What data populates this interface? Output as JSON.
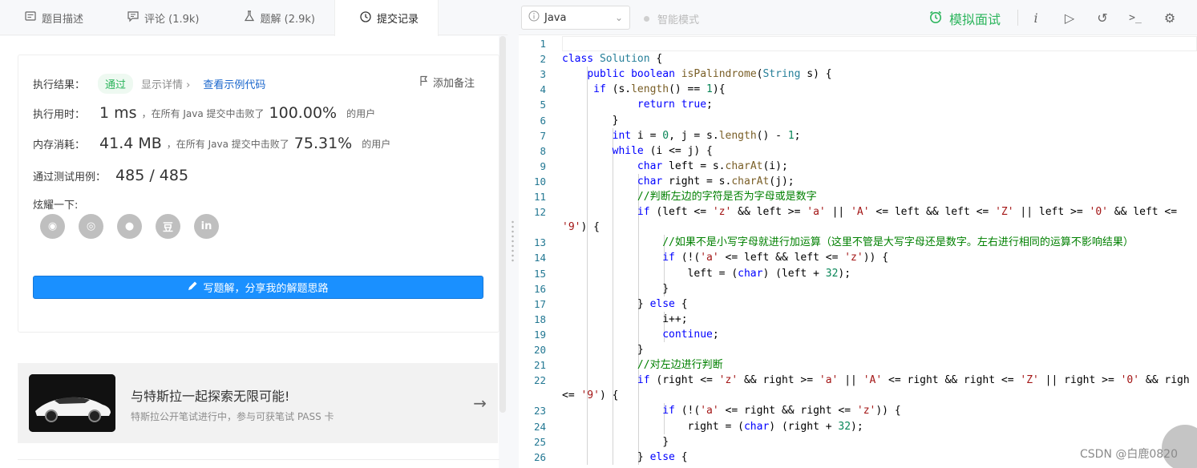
{
  "tabs": [
    {
      "label": "题目描述",
      "icon": "document-icon"
    },
    {
      "label": "评论 (1.9k)",
      "icon": "comment-icon"
    },
    {
      "label": "题解 (2.9k)",
      "icon": "flask-icon"
    },
    {
      "label": "提交记录",
      "icon": "clock-icon"
    }
  ],
  "result": {
    "exec_label": "执行结果：",
    "status": "通过",
    "detail_link": "显示详情 ›",
    "sample_link": "查看示例代码",
    "add_note": "添加备注",
    "time_label": "执行用时：",
    "time_value": "1 ms",
    "time_mid": "，在所有 Java 提交中击败了",
    "time_pct": "100.00%",
    "time_suffix": "的用户",
    "mem_label": "内存消耗：",
    "mem_value": "41.4 MB",
    "mem_mid": "，在所有 Java 提交中击败了",
    "mem_pct": "75.31%",
    "mem_suffix": "的用户",
    "cases_label": "通过测试用例：",
    "cases_value": "485 / 485",
    "share_label": "炫耀一下:",
    "share_icons": [
      "wechat-icon",
      "weibo-icon",
      "qq-icon",
      "douban-icon",
      "linkedin-icon"
    ],
    "share_glyphs": [
      "◉",
      "◎",
      "●",
      "豆",
      "in"
    ],
    "write_button": "写题解，分享我的解题思路"
  },
  "ad": {
    "title": "与特斯拉一起探索无限可能!",
    "subtitle": "特斯拉公开笔试进行中，参与可获笔试 PASS 卡",
    "arrow": "→"
  },
  "toolbar": {
    "language": "Java",
    "smart_mode": "智能模式",
    "mock_interview": "模拟面试",
    "info_glyph": "i",
    "run_glyph": "▷",
    "reset_glyph": "↺",
    "console_glyph": ">_",
    "settings_glyph": "⚙"
  },
  "code_lines": [
    {
      "n": "1",
      "html": ""
    },
    {
      "n": "2",
      "html": "<span class='kw'>class</span> <span class='ty'>Solution</span> {"
    },
    {
      "n": "3",
      "html": "    <span class='kw'>public</span> <span class='kw'>boolean</span> <span class='fn'>isPalindrome</span>(<span class='ty'>String</span> s) {"
    },
    {
      "n": "4",
      "html": "     <span class='kw'>if</span> (s.<span class='fn'>length</span>() == <span class='nm'>1</span>){"
    },
    {
      "n": "5",
      "html": "            <span class='kw'>return</span> <span class='kw'>true</span>;"
    },
    {
      "n": "6",
      "html": "        }"
    },
    {
      "n": "7",
      "html": "        <span class='kw'>int</span> i = <span class='nm'>0</span>, j = s.<span class='fn'>length</span>() - <span class='nm'>1</span>;"
    },
    {
      "n": "8",
      "html": "        <span class='kw'>while</span> (i &lt;= j) {"
    },
    {
      "n": "9",
      "html": "            <span class='kw'>char</span> left = s.<span class='fn'>charAt</span>(i);"
    },
    {
      "n": "10",
      "html": "            <span class='kw'>char</span> right = s.<span class='fn'>charAt</span>(j);"
    },
    {
      "n": "11",
      "html": "            <span class='cm'>//判断左边的字符是否为字母或是数字</span>"
    },
    {
      "n": "12",
      "html": "            <span class='kw'>if</span> (left &lt;= <span class='st'>'z'</span> &amp;&amp; left &gt;= <span class='st'>'a'</span> || <span class='st'>'A'</span> &lt;= left &amp;&amp; left &lt;= <span class='st'>'Z'</span> || left &gt;= <span class='st'>'0'</span> &amp;&amp; left &lt;="
    },
    {
      "n": "",
      "html": "<span class='st'>'9'</span>) {"
    },
    {
      "n": "13",
      "html": "                <span class='cm'>//如果不是小写字母就进行加运算（这里不管是大写字母还是数字。左右进行相同的运算不影响结果）</span>"
    },
    {
      "n": "14",
      "html": "                <span class='kw'>if</span> (!(<span class='st'>'a'</span> &lt;= left &amp;&amp; left &lt;= <span class='st'>'z'</span>)) {"
    },
    {
      "n": "15",
      "html": "                    left = (<span class='kw'>char</span>) (left + <span class='nm'>32</span>);"
    },
    {
      "n": "16",
      "html": "                }"
    },
    {
      "n": "17",
      "html": "            } <span class='kw'>else</span> {"
    },
    {
      "n": "18",
      "html": "                i++;"
    },
    {
      "n": "19",
      "html": "                <span class='kw'>continue</span>;"
    },
    {
      "n": "20",
      "html": "            }"
    },
    {
      "n": "21",
      "html": "            <span class='cm'>//对左边进行判断</span>"
    },
    {
      "n": "22",
      "html": "            <span class='kw'>if</span> (right &lt;= <span class='st'>'z'</span> &amp;&amp; right &gt;= <span class='st'>'a'</span> || <span class='st'>'A'</span> &lt;= right &amp;&amp; right &lt;= <span class='st'>'Z'</span> || right &gt;= <span class='st'>'0'</span> &amp;&amp; righ"
    },
    {
      "n": "",
      "html": "&lt;= <span class='st'>'9'</span>) {"
    },
    {
      "n": "23",
      "html": "                <span class='kw'>if</span> (!(<span class='st'>'a'</span> &lt;= right &amp;&amp; right &lt;= <span class='st'>'z'</span>)) {"
    },
    {
      "n": "24",
      "html": "                    right = (<span class='kw'>char</span>) (right + <span class='nm'>32</span>);"
    },
    {
      "n": "25",
      "html": "                }"
    },
    {
      "n": "26",
      "html": "            } <span class='kw'>else</span> {"
    }
  ],
  "watermark": "CSDN @白鹿0820",
  "colors": {
    "accent_blue": "#1a90ff",
    "success_green": "#2db55d",
    "link_blue": "#1a66cc"
  }
}
